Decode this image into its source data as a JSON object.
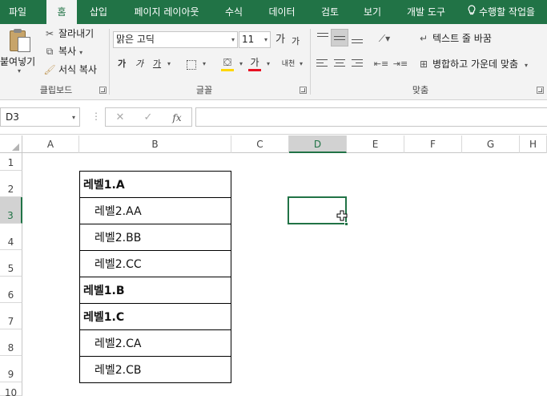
{
  "tabs": [
    "파일",
    "홈",
    "삽입",
    "페이지 레이아웃",
    "수식",
    "데이터",
    "검토",
    "보기",
    "개발 도구"
  ],
  "active_tab": "홈",
  "tell_me": "수행할 작업을",
  "clipboard": {
    "paste_label": "붙여넣기",
    "cut_label": "잘라내기",
    "copy_label": "복사",
    "format_painter_label": "서식 복사",
    "group_label": "클립보드"
  },
  "font": {
    "font_name": "맑은 고딕",
    "font_size": "11",
    "grow_label": "가",
    "shrink_label": "가",
    "bold_label": "가",
    "italic_label": "가",
    "underline_label": "가",
    "font_color_label": "가",
    "phonetic_label": "내천",
    "group_label": "글꼴",
    "font_color": "#e81123",
    "fill_color": "#ffd700"
  },
  "alignment": {
    "wrap_text_label": "텍스트 줄 바꿈",
    "merge_center_label": "병합하고 가운데 맞춤",
    "group_label": "맞춤"
  },
  "formula_bar": {
    "name_box": "D3",
    "cancel_icon": "✕",
    "enter_icon": "✓",
    "fx_label": "fx",
    "formula": ""
  },
  "columns": [
    "A",
    "B",
    "C",
    "D",
    "E",
    "F",
    "G",
    "H"
  ],
  "selected_column": "D",
  "rows": [
    "1",
    "2",
    "3",
    "4",
    "5",
    "6",
    "7",
    "8",
    "9",
    "10"
  ],
  "selected_row": "3",
  "cells": [
    {
      "row": "2",
      "text": "레벨1.A",
      "style": "bold"
    },
    {
      "row": "3",
      "text": "레벨2.AA",
      "style": "indent"
    },
    {
      "row": "4",
      "text": "레벨2.BB",
      "style": "indent"
    },
    {
      "row": "5",
      "text": "레벨2.CC",
      "style": "indent"
    },
    {
      "row": "6",
      "text": "레벨1.B",
      "style": "bold"
    },
    {
      "row": "7",
      "text": "레벨1.C",
      "style": "bold"
    },
    {
      "row": "8",
      "text": "레벨2.CA",
      "style": "indent"
    },
    {
      "row": "9",
      "text": "레벨2.CB",
      "style": "indent"
    }
  ],
  "colors": {
    "accent": "#217346",
    "ribbon_bg": "#f3f3f3"
  }
}
